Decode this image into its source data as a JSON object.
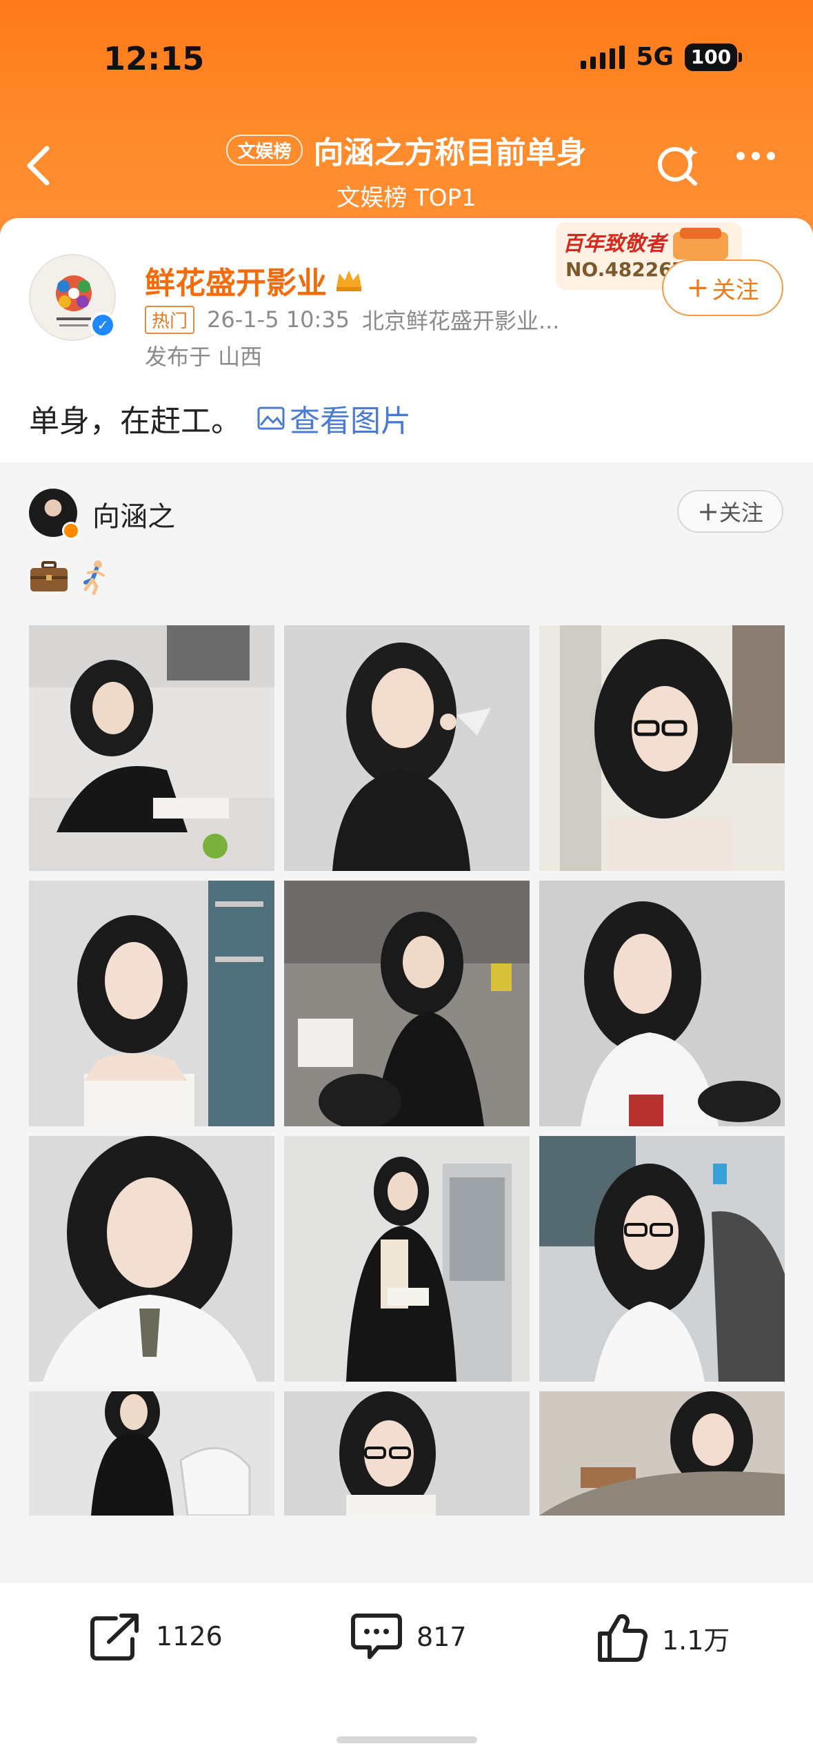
{
  "status_bar": {
    "time": "12:15",
    "network": "5G",
    "battery": "100"
  },
  "header": {
    "tag": "文娱榜",
    "title": "向涵之方称目前单身",
    "subtitle": "文娱榜 TOP1"
  },
  "post": {
    "author": "鲜花盛开影业",
    "hot_tag": "热门",
    "timestamp": "26-1-5 10:35",
    "source": "北京鲜花盛开影业...",
    "location": "发布于 山西",
    "text": "单身，在赶工。",
    "view_images_label": "查看图片",
    "follow_label": "关注",
    "badge_title": "百年致敬者",
    "badge_number": "NO.482267"
  },
  "retweet": {
    "author": "向涵之",
    "follow_label": "关注"
  },
  "actions": {
    "share_count": "1126",
    "comment_count": "817",
    "like_count": "1.1万"
  },
  "colors": {
    "header_orange": "#ff7a1a",
    "author_orange": "#f36b0a",
    "link_blue": "#4a7bd0"
  },
  "icons": [
    "back-icon",
    "search-icon",
    "more-icon",
    "crown-icon",
    "image-icon",
    "share-icon",
    "comment-icon",
    "like-icon"
  ]
}
